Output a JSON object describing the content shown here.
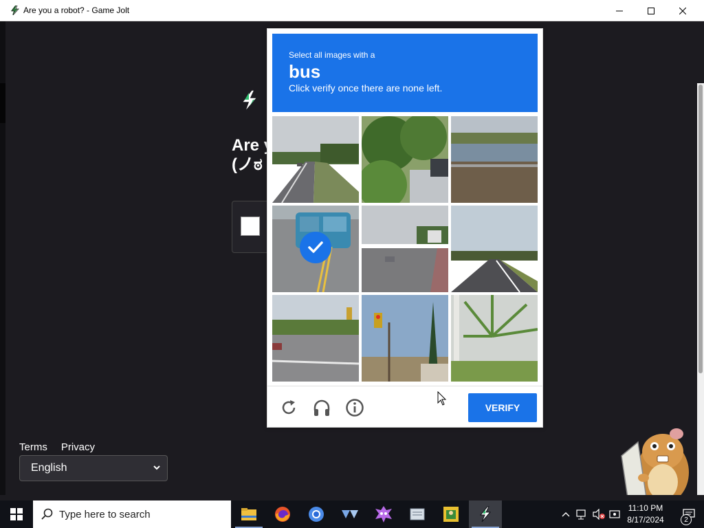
{
  "window": {
    "title": "Are you a robot? - Game Jolt",
    "minimize_glyph": "—",
    "maximize_glyph": "☐",
    "close_glyph": "✕"
  },
  "page": {
    "heading_line1": "Are y",
    "heading_line2": "(ノಠ",
    "footer": {
      "terms": "Terms",
      "privacy": "Privacy"
    },
    "language": {
      "selected": "English"
    }
  },
  "captcha": {
    "instruction_small": "Select all images with a",
    "target": "bus",
    "instruction_sub": "Click verify once there are none left.",
    "tiles": [
      {
        "scene": "road-trees",
        "selected": false
      },
      {
        "scene": "tree-car",
        "selected": false
      },
      {
        "scene": "pond-street",
        "selected": false
      },
      {
        "scene": "bus",
        "selected": true
      },
      {
        "scene": "street-house",
        "selected": false
      },
      {
        "scene": "highway",
        "selected": false
      },
      {
        "scene": "intersection",
        "selected": false
      },
      {
        "scene": "traffic-light",
        "selected": false
      },
      {
        "scene": "palm-tree",
        "selected": false
      }
    ],
    "verify_label": "VERIFY",
    "accent": "#1a73e8"
  },
  "taskbar": {
    "search_placeholder": "Type here to search",
    "apps": [
      "file-explorer",
      "firefox",
      "chromium",
      "app-v",
      "game-skull",
      "notepad-app",
      "game-app",
      "game-jolt"
    ],
    "clock_time": "11:10 PM",
    "clock_date": "8/17/2024",
    "notification_count": "2"
  }
}
